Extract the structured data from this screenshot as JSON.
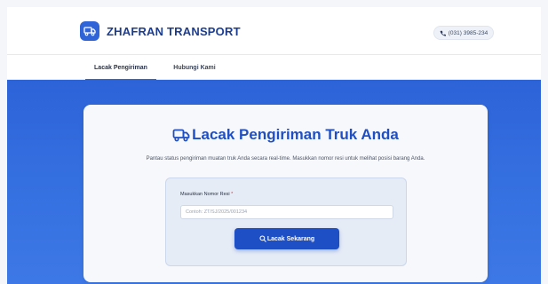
{
  "header": {
    "brand_name": "ZHAFRAN TRANSPORT",
    "phone": "(031) 3985-234",
    "accent_color": "#2f64d8",
    "brand_color": "#1c3d8f"
  },
  "tabs": [
    {
      "label": "Lacak Pengiriman",
      "active": true
    },
    {
      "label": "Hubungi Kami",
      "active": false
    }
  ],
  "hero": {
    "title": "Lacak Pengiriman Truk Anda",
    "subtitle": "Pantau status pengiriman muatan truk Anda secara real-time. Masukkan nomor resi untuk melihat posisi barang Anda.",
    "gradient_color": "#2d63d8"
  },
  "form": {
    "label": "Masukkan Nomor Resi",
    "required_mark": "*",
    "placeholder": "Contoh: ZT/SJ/2025/001234",
    "value": "",
    "button_label": "Lacak Sekarang",
    "button_color": "#1f4fc4"
  },
  "icons": {
    "brand": "truck-icon",
    "phone": "phone-icon",
    "title": "truck-icon",
    "button": "search-icon"
  }
}
